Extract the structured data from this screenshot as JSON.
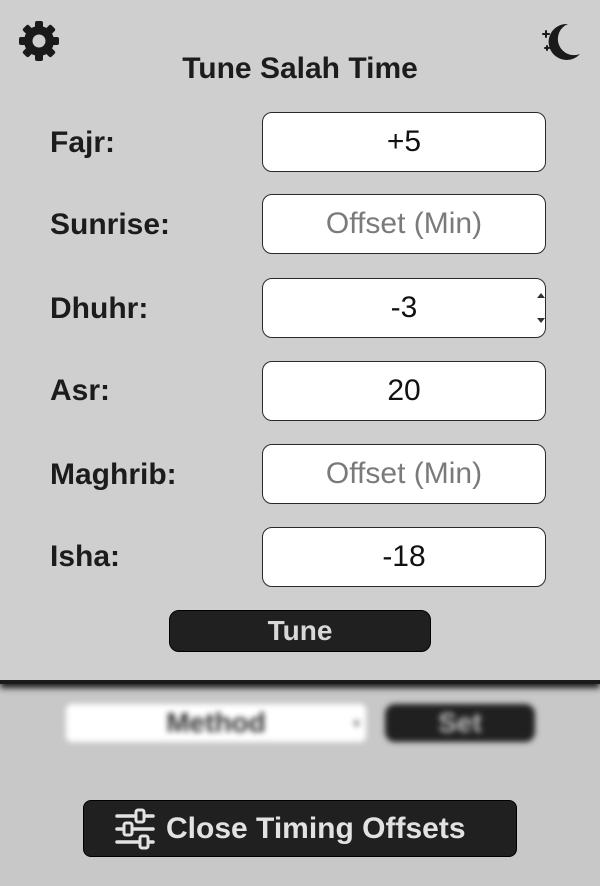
{
  "panel": {
    "title": "Tune Salah Time",
    "settings_icon": "gear-icon",
    "theme_icon": "moon-stars-icon",
    "rows": [
      {
        "label": "Fajr:",
        "value": "+5",
        "placeholder": "Offset (Min)"
      },
      {
        "label": "Sunrise:",
        "value": "",
        "placeholder": "Offset (Min)"
      },
      {
        "label": "Dhuhr:",
        "value": "-3",
        "placeholder": "Offset (Min)"
      },
      {
        "label": "Asr:",
        "value": "20",
        "placeholder": "Offset (Min)"
      },
      {
        "label": "Maghrib:",
        "value": "",
        "placeholder": "Offset (Min)"
      },
      {
        "label": "Isha:",
        "value": "-18",
        "placeholder": "Offset (Min)"
      }
    ],
    "tune_label": "Tune"
  },
  "background": {
    "method_label": "Method",
    "set_label": "Set"
  },
  "footer": {
    "close_label": "Close Timing Offsets",
    "close_icon": "sliders-icon"
  },
  "colors": {
    "background": "#c8c8c8",
    "panel": "#cfcfcf",
    "button": "#202020",
    "button_text": "#e2e2e2"
  }
}
